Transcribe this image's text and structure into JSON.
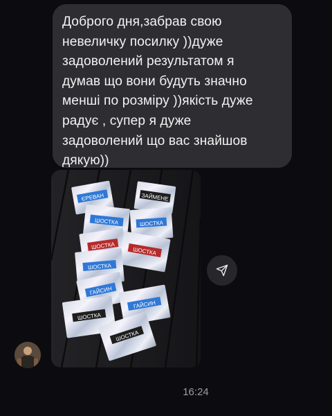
{
  "message": {
    "text": "Доброго дня,забрав свою\nневеличку посилку ))дуже\nзадоволений результатом я\nдумав що вони будуть значно\nменші по розміру ))якість дуже\nрадує , супер я дуже\nзадоволений що вас знайшов\nдякую))"
  },
  "photo": {
    "tags": [
      "ЄРЕВАН",
      "ЗАЙМЕНЕ",
      "ШОСТКА",
      "ШОСТКА",
      "ШОСТКА",
      "ШОСТКА",
      "ШОСТКА",
      "ГАЙСИН",
      "ГАЙСИН",
      "ШОСТКА",
      "ШОСТКА"
    ]
  },
  "actions": {
    "share_icon": "share-icon"
  },
  "meta": {
    "time": "16:24"
  },
  "colors": {
    "bubble": "#2d2d32",
    "background": "#0c0c10",
    "tag_blue": "#2f78d6",
    "tag_red": "#b52b2b",
    "tag_black": "#1e1e1e"
  }
}
